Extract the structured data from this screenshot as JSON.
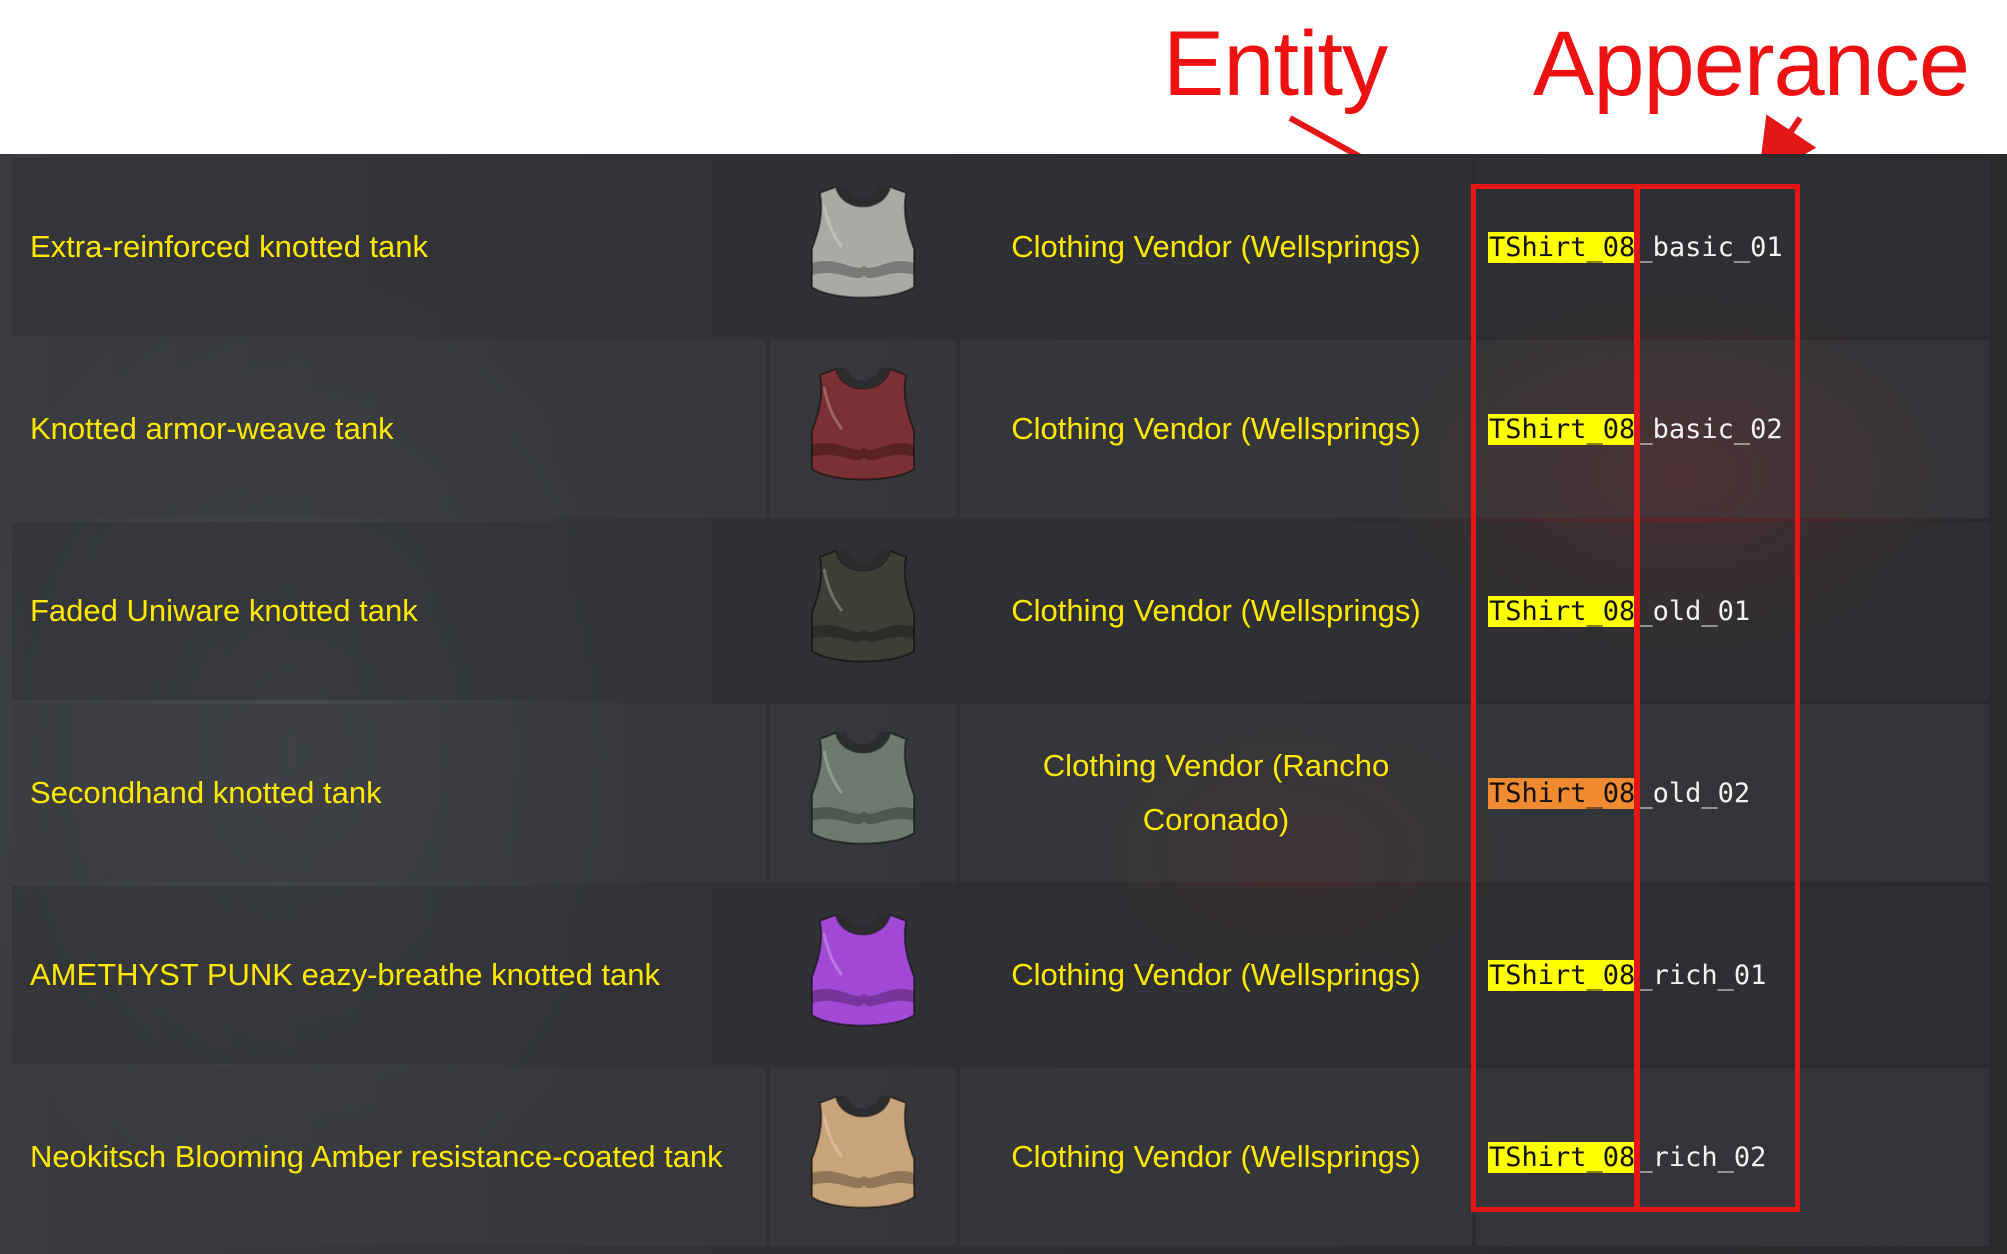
{
  "annotations": {
    "entity_label": "Entity",
    "appearance_label": "Apperance",
    "color": "#e51616"
  },
  "rows": [
    {
      "name": "Extra-reinforced knotted tank",
      "icon": "tank-top-white-icon",
      "icon_color": "#a8aaa6",
      "vendor": "Clothing Vendor (Wellsprings)",
      "entity": "TShirt_08",
      "entity_highlight": "#ffff00",
      "appearance": "_basic_01"
    },
    {
      "name": "Knotted armor-weave tank",
      "icon": "tank-top-red-icon",
      "icon_color": "#7a3034",
      "vendor": "Clothing Vendor (Wellsprings)",
      "entity": "TShirt_08",
      "entity_highlight": "#ffff00",
      "appearance": "_basic_02"
    },
    {
      "name": "Faded Uniware knotted tank",
      "icon": "tank-top-olive-icon",
      "icon_color": "#3d3f37",
      "vendor": "Clothing Vendor (Wellsprings)",
      "entity": "TShirt_08",
      "entity_highlight": "#ffff00",
      "appearance": "_old_01"
    },
    {
      "name": "Secondhand knotted tank",
      "icon": "tank-top-gray-green-icon",
      "icon_color": "#6d7a70",
      "vendor": "Clothing Vendor (Rancho Coronado)",
      "entity": "TShirt_08",
      "entity_highlight": "#f08a30",
      "appearance": "_old_02"
    },
    {
      "name": "AMETHYST PUNK eazy-breathe knotted tank",
      "icon": "tank-top-purple-icon",
      "icon_color": "#a24ad6",
      "vendor": "Clothing Vendor (Wellsprings)",
      "entity": "TShirt_08",
      "entity_highlight": "#ffff00",
      "appearance": "_rich_01"
    },
    {
      "name": "Neokitsch Blooming Amber resistance-coated tank",
      "icon": "tank-top-amber-icon",
      "icon_color": "#c9a37a",
      "vendor": "Clothing Vendor (Wellsprings)",
      "entity": "TShirt_08",
      "entity_highlight": "#ffff00",
      "appearance": "_rich_02"
    }
  ]
}
